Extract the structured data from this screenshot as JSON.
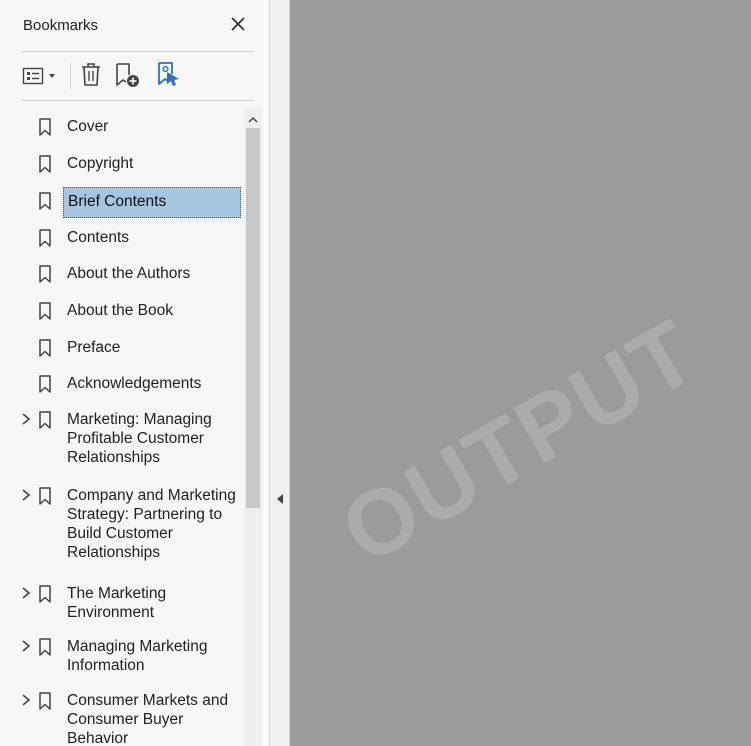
{
  "panel": {
    "title": "Bookmarks",
    "close_icon": "close-icon"
  },
  "toolbar": {
    "options_icon": "options-menu-icon",
    "delete_icon": "trash-icon",
    "new_bookmark_icon": "new-bookmark-icon",
    "find_bookmark_icon": "find-current-bookmark-icon"
  },
  "bookmarks": [
    {
      "label": "Cover",
      "expandable": false,
      "selected": false
    },
    {
      "label": "Copyright",
      "expandable": false,
      "selected": false
    },
    {
      "label": "Brief Contents",
      "expandable": false,
      "selected": true
    },
    {
      "label": "Contents",
      "expandable": false,
      "selected": false
    },
    {
      "label": "About the Authors",
      "expandable": false,
      "selected": false
    },
    {
      "label": "About the Book",
      "expandable": false,
      "selected": false
    },
    {
      "label": "Preface",
      "expandable": false,
      "selected": false
    },
    {
      "label": "Acknowledgements",
      "expandable": false,
      "selected": false
    },
    {
      "label": "Marketing: Managing Profitable Customer Relationships",
      "expandable": true,
      "selected": false
    },
    {
      "label": "Company and Marketing Strategy: Partnering to Build Customer Relationships",
      "expandable": true,
      "selected": false
    },
    {
      "label": "The Marketing Environment",
      "expandable": true,
      "selected": false
    },
    {
      "label": "Managing Marketing Information",
      "expandable": true,
      "selected": false
    },
    {
      "label": "Consumer Markets and Consumer Buyer Behavior",
      "expandable": true,
      "selected": false
    }
  ],
  "document": {
    "watermark": "OUTPUT"
  },
  "colors": {
    "selection": "#a4c6e0",
    "accent_icon": "#2b72c2",
    "doc_background": "#9b9b9b"
  }
}
